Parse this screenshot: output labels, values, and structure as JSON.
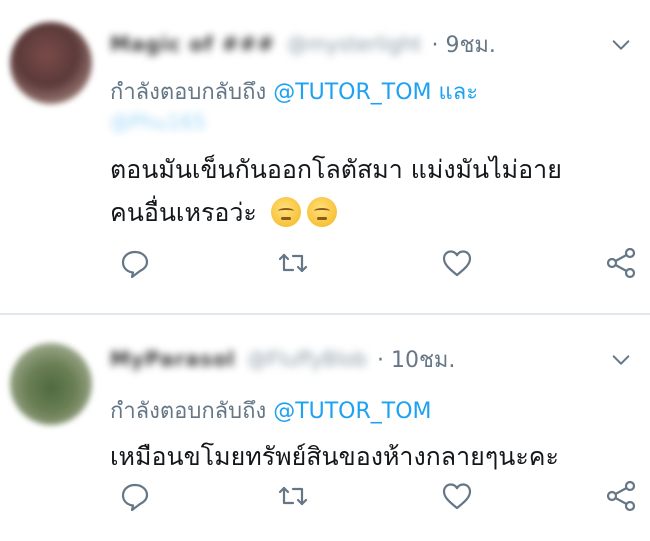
{
  "tweets": [
    {
      "author_name": "Magic of ###",
      "author_handle": "@mysterlight",
      "time": "· 9ชม.",
      "reply_prefix": "กำลังตอบกลับถึง",
      "reply_mention": "@TUTOR_TOM",
      "reply_and": "และ",
      "reply_mention_2": "@Phu165",
      "body_line_1": "ตอนมันเข็นกันออกโลตัสมา แม่งมันไม่อาย",
      "body_line_2": "คนอื่นเหรอว่ะ",
      "emojis": [
        "pensive-face-emoji",
        "pensive-face-emoji"
      ]
    },
    {
      "author_name": "MyParasol",
      "author_handle": "@FluffyBlob",
      "time": "· 10ชม.",
      "reply_prefix": "กำลังตอบกลับถึง",
      "reply_mention": "@TUTOR_TOM",
      "body_line_1": "เหมือนขโมยทรัพย์สินของห้างกลายๆนะคะ"
    }
  ],
  "icons": {
    "reply": "reply-icon",
    "retweet": "retweet-icon",
    "like": "heart-icon",
    "share": "share-icon",
    "menu": "chevron-down-icon"
  },
  "colors": {
    "mention": "#1da1f2",
    "muted": "#657786",
    "text": "#14171a",
    "divider": "#e1e8ed"
  }
}
